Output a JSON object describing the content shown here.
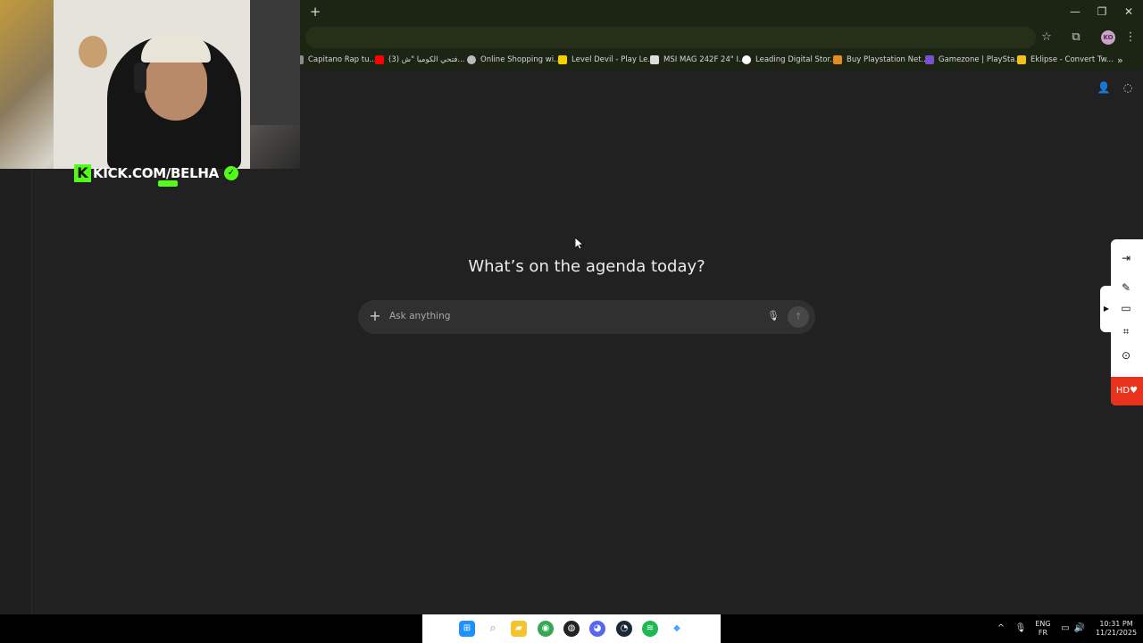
{
  "webcam": {
    "brand_letter": "K",
    "brand_text": "KICK.COM/BELHA",
    "verified_icon": "verified-check-icon"
  },
  "browser": {
    "new_tab_label": "+",
    "window_controls": {
      "minimize": "—",
      "restore": "❐",
      "close": "✕"
    },
    "toolbar": {
      "star_icon": "☆",
      "extensions_icon": "⧉",
      "avatar_text": "KO",
      "menu_icon": "⋮"
    },
    "bookmarks": [
      {
        "label": "Capitano Rap tu...",
        "icon_color": "#8a8a8a"
      },
      {
        "label": "(3) فتحي الكوميا \"ش...",
        "icon_color": "#ff0000"
      },
      {
        "label": "Online Shopping wi...",
        "icon_color": "#bbbbbb"
      },
      {
        "label": "Level Devil - Play Le...",
        "icon_color": "#f5d000"
      },
      {
        "label": "MSI MAG 242F 24\" I...",
        "icon_color": "#dddddd"
      },
      {
        "label": "Leading Digital Stor...",
        "icon_color": "#ffffff"
      },
      {
        "label": "Buy Playstation Net...",
        "icon_color": "#e58c1e"
      },
      {
        "label": "Gamezone | PlaySta...",
        "icon_color": "#7a4fd0"
      },
      {
        "label": "Eklipse - Convert Tw...",
        "icon_color": "#f0c020"
      }
    ],
    "bookmarks_overflow": "»"
  },
  "chat": {
    "headline": "What’s on the agenda today?",
    "composer": {
      "plus_label": "+",
      "placeholder": "Ask anything",
      "mic_icon": "🎙",
      "send_icon": "↑"
    },
    "top_right_icons": [
      "👤",
      "◌"
    ]
  },
  "tool_panel": {
    "collapse_label": "▶",
    "icons": [
      "⇥",
      "✎",
      "▭",
      "⌗",
      "⊙"
    ],
    "hd_label": "HD♥"
  },
  "taskbar": {
    "icons": [
      {
        "name": "windows-start-icon",
        "glyph": "⊞",
        "color": "#1e90ff"
      },
      {
        "name": "search-icon",
        "glyph": "⌕",
        "color": "#9a9a9a"
      },
      {
        "name": "file-explorer-icon",
        "glyph": "▰",
        "color": "#f4c430"
      },
      {
        "name": "chrome-icon",
        "glyph": "◉",
        "color": "#34a853"
      },
      {
        "name": "obs-icon",
        "glyph": "◍",
        "color": "#222222"
      },
      {
        "name": "discord-icon",
        "glyph": "◕",
        "color": "#5865f2"
      },
      {
        "name": "steam-icon",
        "glyph": "◔",
        "color": "#1b2838"
      },
      {
        "name": "spotify-icon",
        "glyph": "≋",
        "color": "#1db954"
      },
      {
        "name": "app-icon",
        "glyph": "◆",
        "color": "#4aa3ff"
      }
    ],
    "tray": {
      "chevron": "^",
      "mic": "🎙",
      "lang_top": "ENG",
      "lang_bottom": "FR",
      "network": "▭",
      "volume": "🔊",
      "time": "10:31 PM",
      "date": "11/21/2025"
    }
  }
}
